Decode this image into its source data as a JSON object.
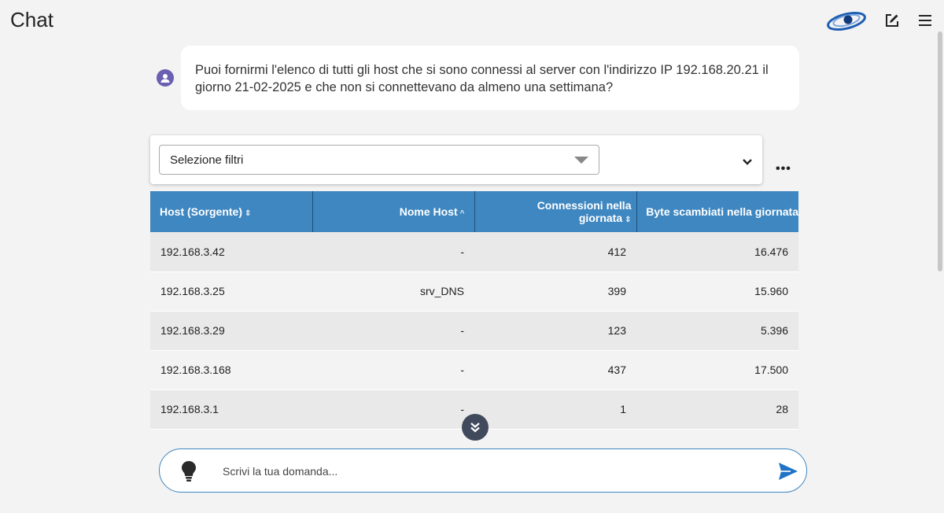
{
  "app": {
    "title": "Chat"
  },
  "header": {
    "icons": [
      "logo-icon",
      "edit-icon",
      "menu-icon"
    ]
  },
  "message": {
    "text": "Puoi fornirmi l'elenco di tutti gli host che si sono connessi al server con l'indirizzo IP 192.168.20.21 il giorno 21-02-2025 e che non si connettevano da almeno una settimana?"
  },
  "filters": {
    "placeholder": "Selezione filtri",
    "more": "•••"
  },
  "table": {
    "columns": [
      {
        "label": "Host (Sorgente)",
        "sort": "⇕"
      },
      {
        "label": "Nome Host",
        "sort": "^"
      },
      {
        "label": "Connessioni nella giornata",
        "sort": "⇕"
      },
      {
        "label": "Byte scambiati nella giornata",
        "sort": ""
      }
    ],
    "rows": [
      {
        "host": "192.168.3.42",
        "name": "-",
        "connections": "412",
        "bytes": "16.476"
      },
      {
        "host": "192.168.3.25",
        "name": "srv_DNS",
        "connections": "399",
        "bytes": "15.960"
      },
      {
        "host": "192.168.3.29",
        "name": "-",
        "connections": "123",
        "bytes": "5.396"
      },
      {
        "host": "192.168.3.168",
        "name": "-",
        "connections": "437",
        "bytes": "17.500"
      },
      {
        "host": "192.168.3.1",
        "name": "-",
        "connections": "1",
        "bytes": "28"
      }
    ]
  },
  "input": {
    "placeholder": "Scrivi la tua domanda...",
    "value": ""
  },
  "colors": {
    "accent": "#3f87c1",
    "avatar": "#6a5fb0",
    "scroll_button": "#404a5c"
  }
}
